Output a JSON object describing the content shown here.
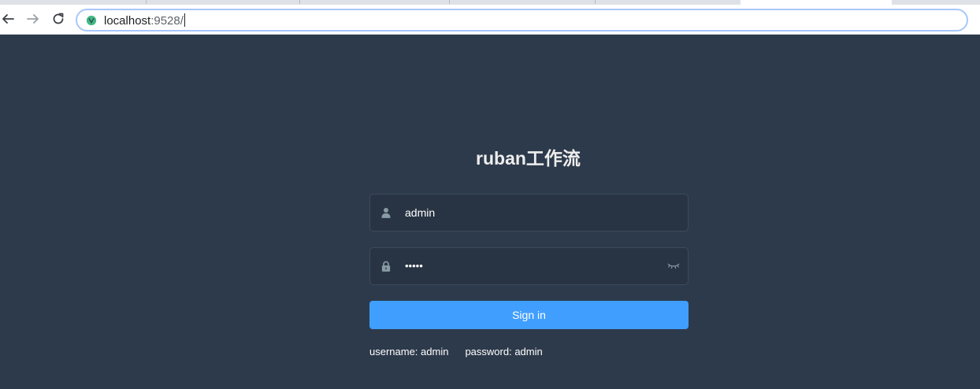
{
  "browser": {
    "url_host": "localhost",
    "url_port": ":9528/"
  },
  "login": {
    "title": "ruban工作流",
    "username_value": "admin",
    "password_masked": "•••••",
    "signin_label": "Sign in",
    "tip_username": "username: admin",
    "tip_password": "password: admin"
  },
  "colors": {
    "background": "#2d3a4b",
    "input_background": "#283443",
    "primary_button": "#409eff"
  },
  "icons": [
    "back-arrow-icon",
    "forward-arrow-icon",
    "reload-icon",
    "vue-site-icon",
    "user-icon",
    "lock-icon",
    "eye-closed-icon"
  ]
}
